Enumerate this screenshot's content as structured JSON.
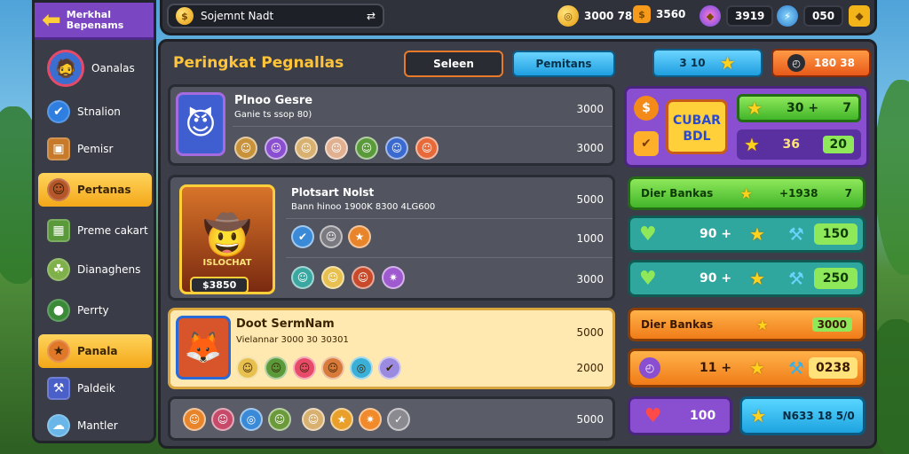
{
  "sidebar": {
    "title_line1": "Merkhal",
    "title_line2": "Bepenams",
    "items": [
      {
        "label": "Oanalas"
      },
      {
        "label": "Stnalion"
      },
      {
        "label": "Pemisr"
      },
      {
        "label": "Pertanas"
      },
      {
        "label": "Preme cakart"
      },
      {
        "label": "Dianaghens"
      },
      {
        "label": "Perrty"
      },
      {
        "label": "Panala"
      },
      {
        "label": "Paldeik"
      },
      {
        "label": "Mantler"
      }
    ]
  },
  "topbar": {
    "search_text": "Sojemnt Nadt",
    "res1": "3000 78",
    "res2": "3560",
    "res3": "3919",
    "res4": "050"
  },
  "main": {
    "title": "Peringkat Pegnallas",
    "btn_search": "Seleen",
    "btn_filter": "Pemitans",
    "top_right_blue": "3 10",
    "top_right_orange": "180 38"
  },
  "cards": [
    {
      "name": "Plnoo Gesre",
      "sub": "Ganie ts ssop 80)",
      "val1": "3000",
      "val2": "3000"
    },
    {
      "name": "Plotsart Nolst",
      "sub": "Bann hinoo 1900K 8300 4LG600",
      "val1": "5000",
      "val2": "1000",
      "val3": "3000",
      "badge": "$3850",
      "portrait_text": "ISLOCHAT"
    },
    {
      "name": "Doot SermNam",
      "sub": "Vielannar 3000 30 30301",
      "val1": "5000",
      "val2": "2000",
      "val3": "5000"
    }
  ],
  "right": {
    "logo_text": "CUBAR BDL",
    "r1a": "30 +",
    "r1b": "7",
    "r2a": "36",
    "r2b": "20",
    "green_label": "Dier Bankas",
    "green_val": "+1938",
    "green_val2": "7",
    "teal1_a": "90 +",
    "teal1_b": "150",
    "teal2_a": "90 +",
    "teal2_b": "250",
    "orange_label": "Dier Bankas",
    "orange_val": "3000",
    "orange2_a": "11 +",
    "orange2_b": "0238",
    "purple_bottom": "100",
    "cyan_bottom": "N633 18 5/0"
  }
}
